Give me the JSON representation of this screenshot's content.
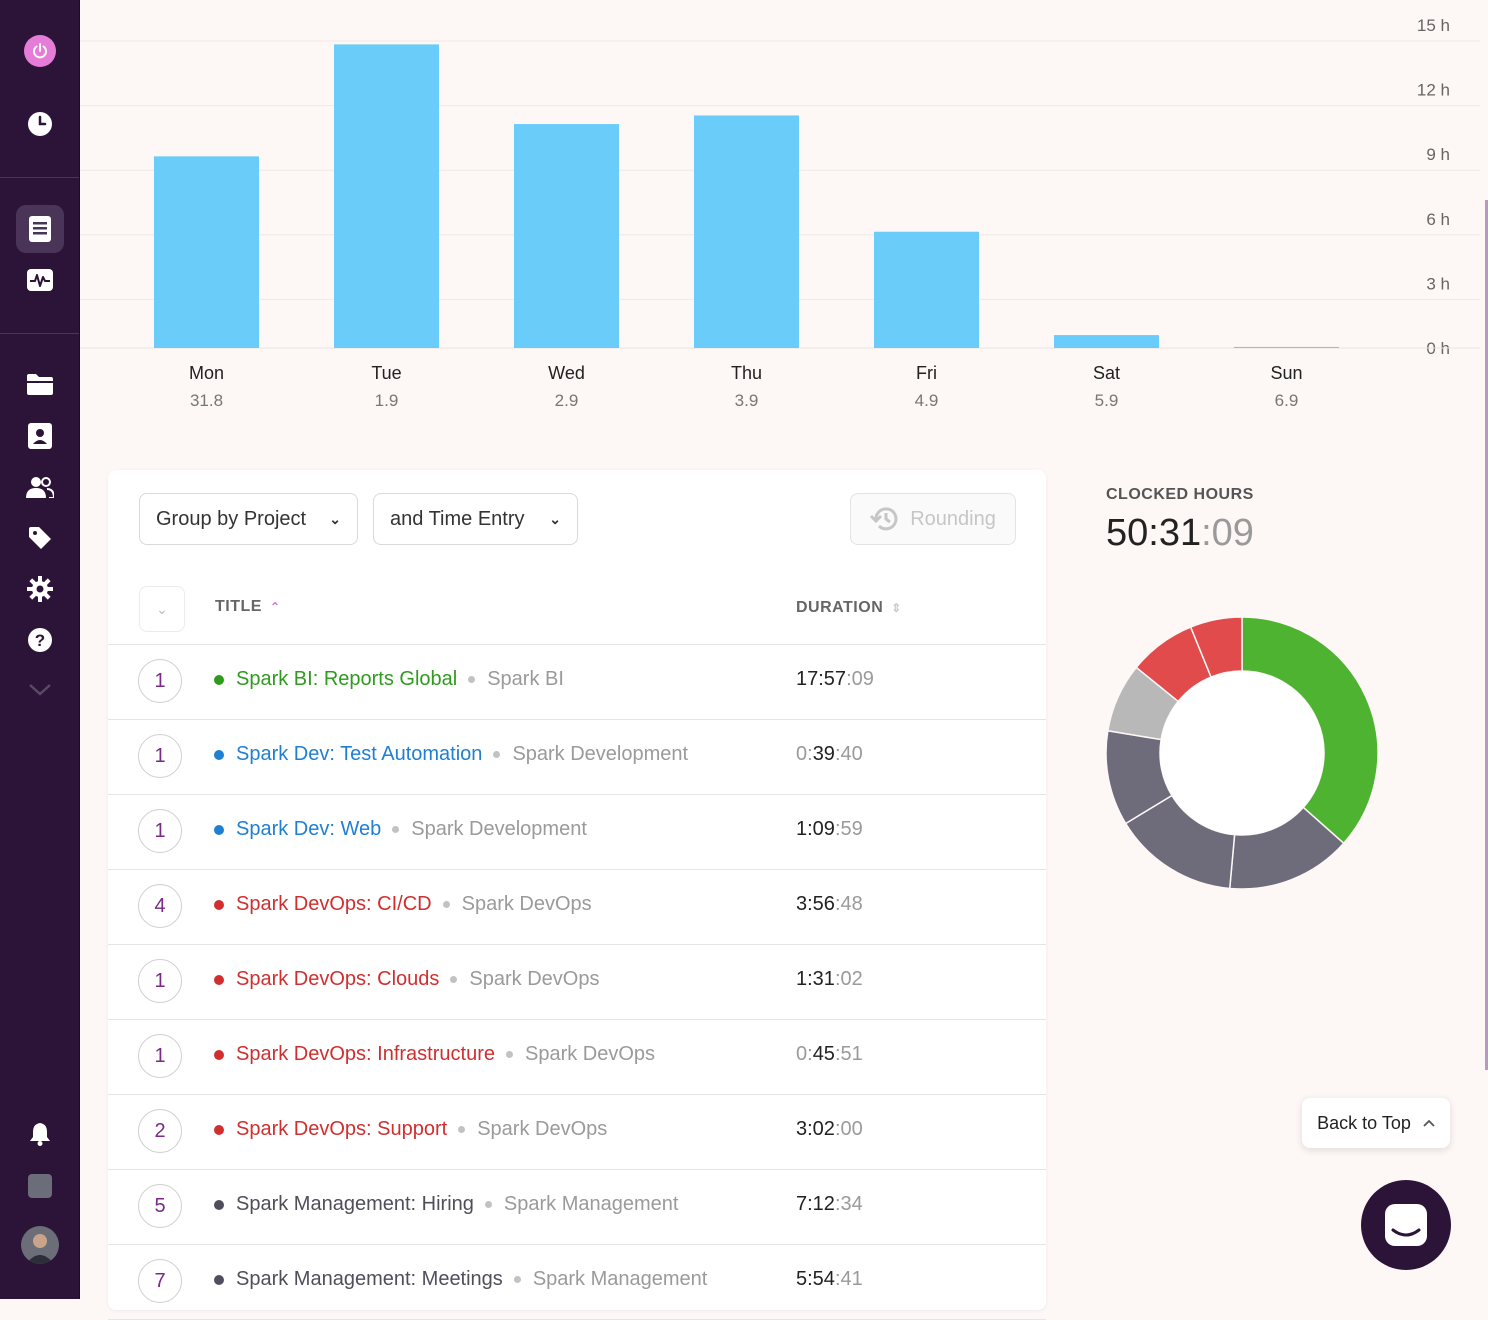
{
  "chart_data": {
    "type": "bar",
    "categories": [
      "Mon",
      "Tue",
      "Wed",
      "Thu",
      "Fri",
      "Sat",
      "Sun"
    ],
    "sublabels": [
      "31.8",
      "1.9",
      "2.9",
      "3.9",
      "4.9",
      "5.9",
      "6.9"
    ],
    "values": [
      8.9,
      14.1,
      10.4,
      10.8,
      5.4,
      0.6,
      0.05
    ],
    "ylim": [
      0,
      15
    ],
    "yticks": [
      "15 h",
      "12 h",
      "9 h",
      "6 h",
      "3 h",
      "0 h"
    ],
    "yticks_values": [
      15,
      12,
      9,
      6,
      3,
      0
    ],
    "color": "#6acdf9",
    "grid": true
  },
  "toolbar": {
    "group_by": "Group by Project",
    "and_by": "and Time Entry",
    "rounding": "Rounding"
  },
  "table": {
    "col_title": "TITLE",
    "col_duration": "DURATION",
    "rows": [
      {
        "count": "1",
        "title": "Spark BI: Reports Global",
        "client": "Spark BI",
        "color": "#2f9b1e",
        "dur_main": "17:57",
        "dur_sec": ":09",
        "dur_pre": ""
      },
      {
        "count": "1",
        "title": "Spark Dev: Test Automation",
        "client": "Spark Development",
        "color": "#1f7fd1",
        "dur_pre": "0:",
        "dur_main": "39",
        "dur_sec": ":40"
      },
      {
        "count": "1",
        "title": "Spark Dev: Web",
        "client": "Spark Development",
        "color": "#1f7fd1",
        "dur_pre": "",
        "dur_main": "1:09",
        "dur_sec": ":59"
      },
      {
        "count": "4",
        "title": "Spark DevOps: CI/CD",
        "client": "Spark DevOps",
        "color": "#d12f2f",
        "dur_pre": "",
        "dur_main": "3:56",
        "dur_sec": ":48"
      },
      {
        "count": "1",
        "title": "Spark DevOps: Clouds",
        "client": "Spark DevOps",
        "color": "#d12f2f",
        "dur_pre": "",
        "dur_main": "1:31",
        "dur_sec": ":02"
      },
      {
        "count": "1",
        "title": "Spark DevOps: Infrastructure",
        "client": "Spark DevOps",
        "color": "#d12f2f",
        "dur_pre": "0:",
        "dur_main": "45",
        "dur_sec": ":51"
      },
      {
        "count": "2",
        "title": "Spark DevOps: Support",
        "client": "Spark DevOps",
        "color": "#d12f2f",
        "dur_pre": "",
        "dur_main": "3:02",
        "dur_sec": ":00"
      },
      {
        "count": "5",
        "title": "Spark Management: Hiring",
        "client": "Spark Management",
        "color": "#4f4f5c",
        "dur_pre": "",
        "dur_main": "7:12",
        "dur_sec": ":34"
      },
      {
        "count": "7",
        "title": "Spark Management: Meetings",
        "client": "Spark Management",
        "color": "#4f4f5c",
        "dur_pre": "",
        "dur_main": "5:54",
        "dur_sec": ":41"
      }
    ]
  },
  "clocked": {
    "label": "CLOCKED HOURS",
    "main": "50:31",
    "sec": ":09"
  },
  "donut": {
    "segments": [
      {
        "value": 35.6,
        "color": "#4db330"
      },
      {
        "value": 14.5,
        "color": "#6e6b7a"
      },
      {
        "value": 14.5,
        "color": "#6e6b7a"
      },
      {
        "value": 11.0,
        "color": "#6e6b7a"
      },
      {
        "value": 8.0,
        "color": "#b8b8b8"
      },
      {
        "value": 7.8,
        "color": "#e24b4b"
      },
      {
        "value": 6.0,
        "color": "#e24b4b"
      }
    ]
  },
  "back_to_top": "Back to Top",
  "icons": [
    "power-icon",
    "clock-icon",
    "reports-icon",
    "activity-icon",
    "folder-icon",
    "contacts-icon",
    "team-icon",
    "tag-icon",
    "gear-icon",
    "help-icon",
    "chevron-down-icon",
    "bell-icon",
    "chat-icon"
  ]
}
